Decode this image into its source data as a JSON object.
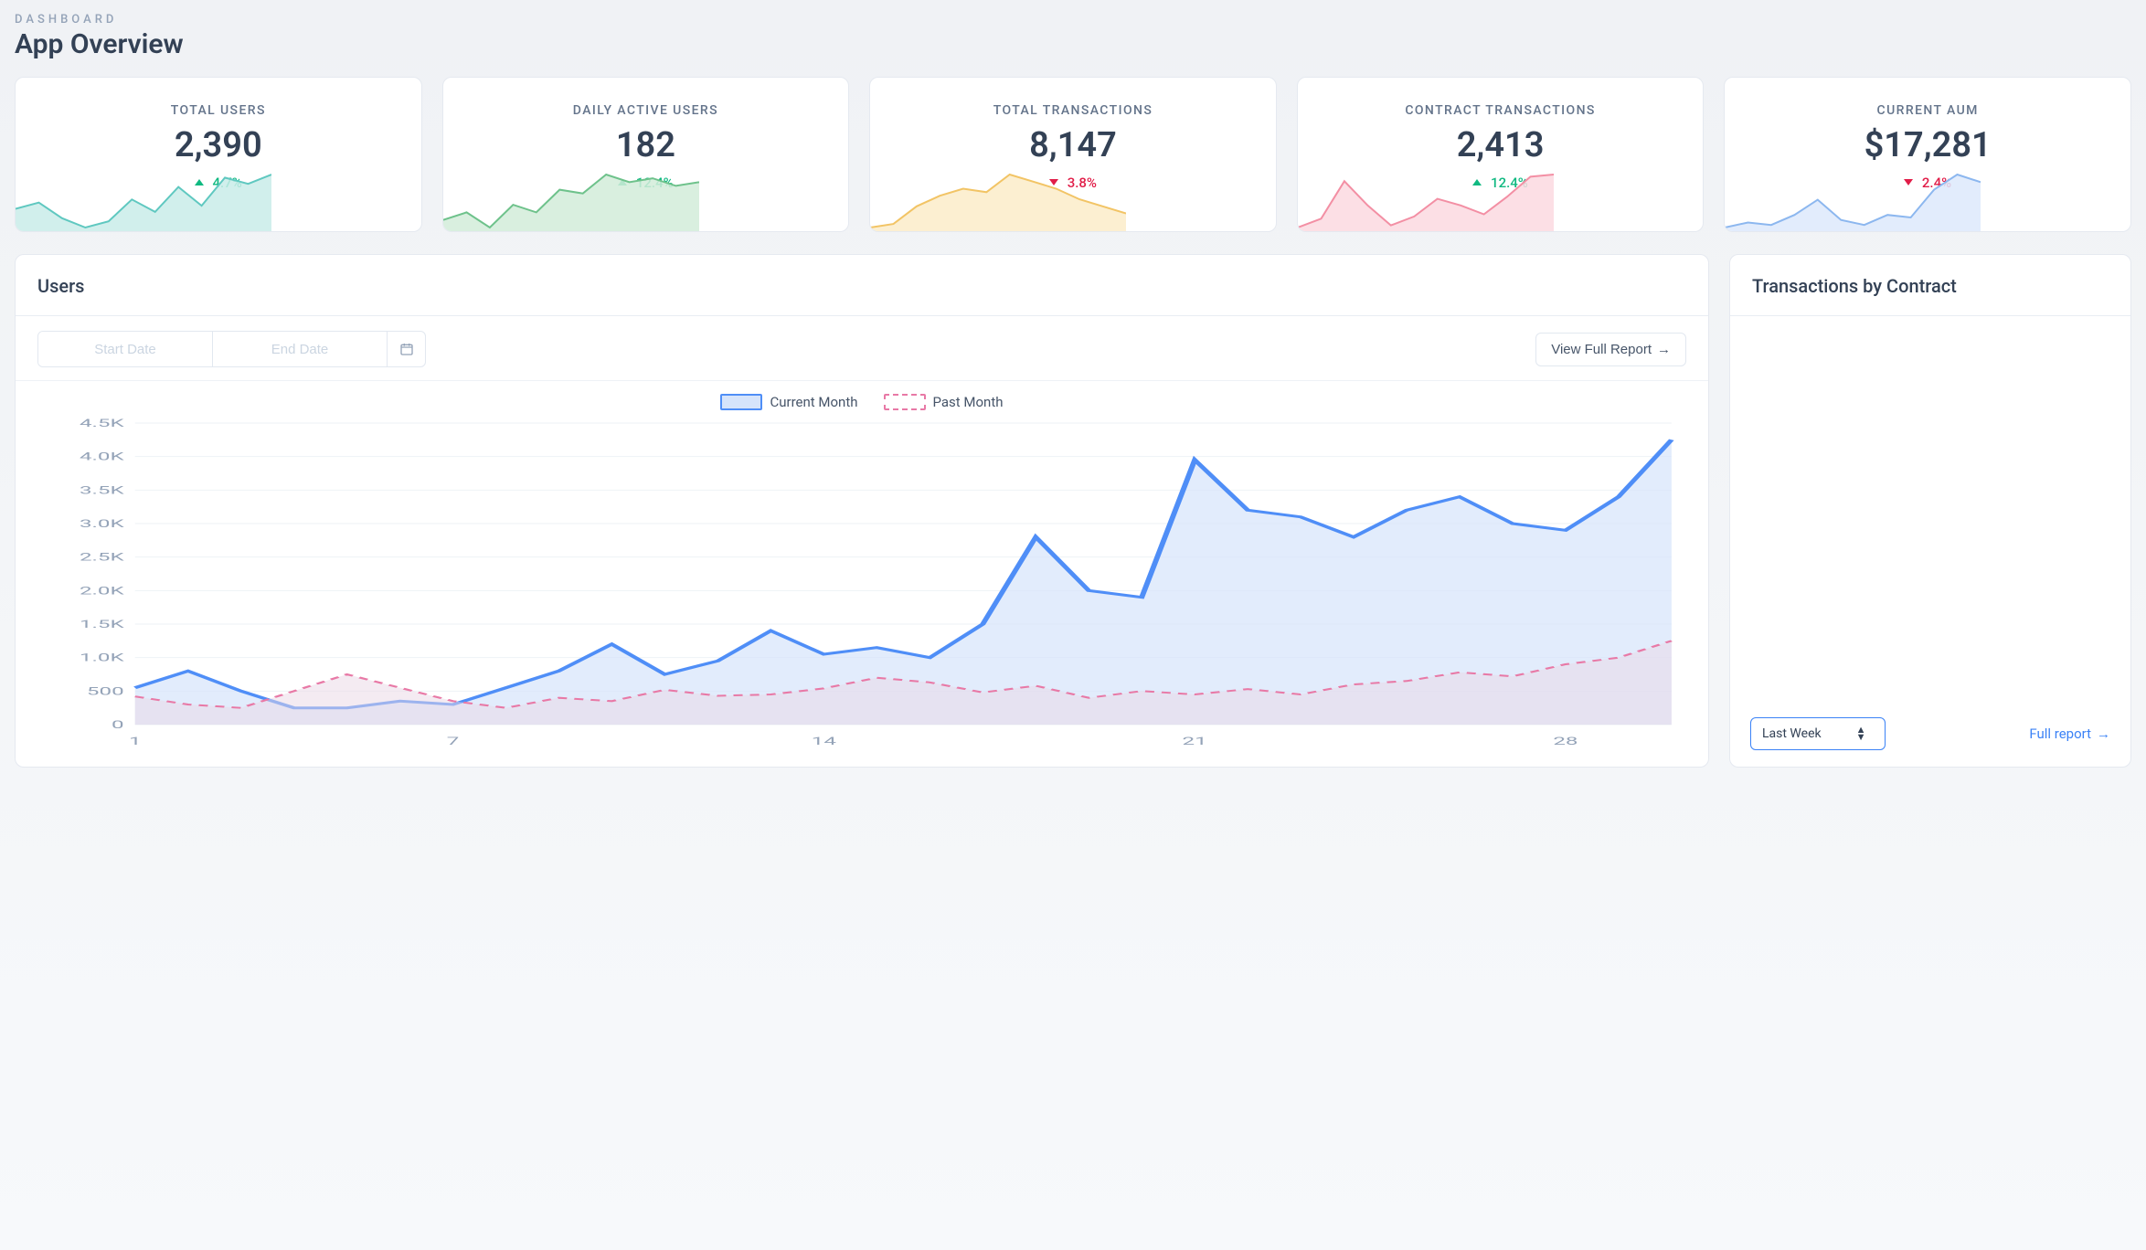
{
  "header": {
    "eyebrow": "DASHBOARD",
    "title": "App Overview"
  },
  "stats": [
    {
      "id": "total-users",
      "label": "TOTAL USERS",
      "value": "2,390",
      "delta_dir": "up",
      "delta": "4.7%",
      "color_stroke": "#5fc8c0",
      "color_fill": "#c9ece9"
    },
    {
      "id": "daily-active-users",
      "label": "DAILY ACTIVE USERS",
      "value": "182",
      "delta_dir": "up",
      "delta": "12.4%",
      "color_stroke": "#6ec28b",
      "color_fill": "#d2ecd9"
    },
    {
      "id": "total-transactions",
      "label": "TOTAL TRANSACTIONS",
      "value": "8,147",
      "delta_dir": "down",
      "delta": "3.8%",
      "color_stroke": "#f2c465",
      "color_fill": "#fbecc9"
    },
    {
      "id": "contract-transactions",
      "label": "CONTRACT TRANSACTIONS",
      "value": "2,413",
      "delta_dir": "up",
      "delta": "12.4%",
      "color_stroke": "#f38fa4",
      "color_fill": "#fbd9e0"
    },
    {
      "id": "current-aum",
      "label": "CURRENT AUM",
      "value": "$17,281",
      "delta_dir": "down",
      "delta": "2.4%",
      "color_stroke": "#8cb7ef",
      "color_fill": "#dde9fb"
    }
  ],
  "users_panel": {
    "title": "Users",
    "start_placeholder": "Start Date",
    "end_placeholder": "End Date",
    "view_report": "View Full Report",
    "legend_current": "Current Month",
    "legend_past": "Past Month"
  },
  "trx_panel": {
    "title": "Transactions by Contract",
    "range_selected": "Last Week",
    "full_report": "Full report"
  },
  "chart_data": {
    "type": "line",
    "title": "Users",
    "xlabel": "",
    "ylabel": "",
    "ylim": [
      0,
      4500
    ],
    "y_ticks": [
      "0",
      "500",
      "1.0K",
      "1.5K",
      "2.0K",
      "2.5K",
      "3.0K",
      "3.5K",
      "4.0K",
      "4.5K"
    ],
    "x_ticks": [
      "1",
      "7",
      "14",
      "21",
      "28"
    ],
    "x": [
      1,
      2,
      3,
      4,
      5,
      6,
      7,
      8,
      9,
      10,
      11,
      12,
      13,
      14,
      15,
      16,
      17,
      18,
      19,
      20,
      21,
      22,
      23,
      24,
      25,
      26,
      27,
      28,
      29,
      30
    ],
    "series": [
      {
        "name": "Current Month",
        "style": "solid",
        "color": "#4f8ef7",
        "values": [
          550,
          800,
          500,
          250,
          250,
          350,
          300,
          550,
          800,
          1200,
          750,
          950,
          1400,
          1050,
          1150,
          1000,
          1500,
          2800,
          2000,
          1900,
          3950,
          3200,
          3100,
          2800,
          3200,
          3400,
          3000,
          2900,
          3400,
          4250
        ]
      },
      {
        "name": "Past Month",
        "style": "dashed",
        "color": "#e879a6",
        "values": [
          420,
          300,
          250,
          500,
          750,
          550,
          350,
          250,
          400,
          350,
          520,
          430,
          450,
          540,
          700,
          630,
          480,
          580,
          400,
          500,
          450,
          530,
          450,
          600,
          650,
          780,
          720,
          900,
          1000,
          1250
        ]
      }
    ]
  },
  "sparklines": [
    [
      30,
      34,
      24,
      18,
      22,
      36,
      28,
      44,
      32,
      50,
      46,
      52
    ],
    [
      26,
      30,
      22,
      34,
      30,
      42,
      40,
      50,
      46,
      48,
      44,
      46
    ],
    [
      18,
      20,
      30,
      36,
      40,
      38,
      48,
      44,
      40,
      34,
      30,
      26
    ],
    [
      10,
      18,
      52,
      30,
      12,
      20,
      36,
      30,
      22,
      38,
      56,
      58
    ],
    [
      14,
      18,
      16,
      24,
      36,
      20,
      16,
      24,
      22,
      44,
      56,
      50
    ]
  ]
}
